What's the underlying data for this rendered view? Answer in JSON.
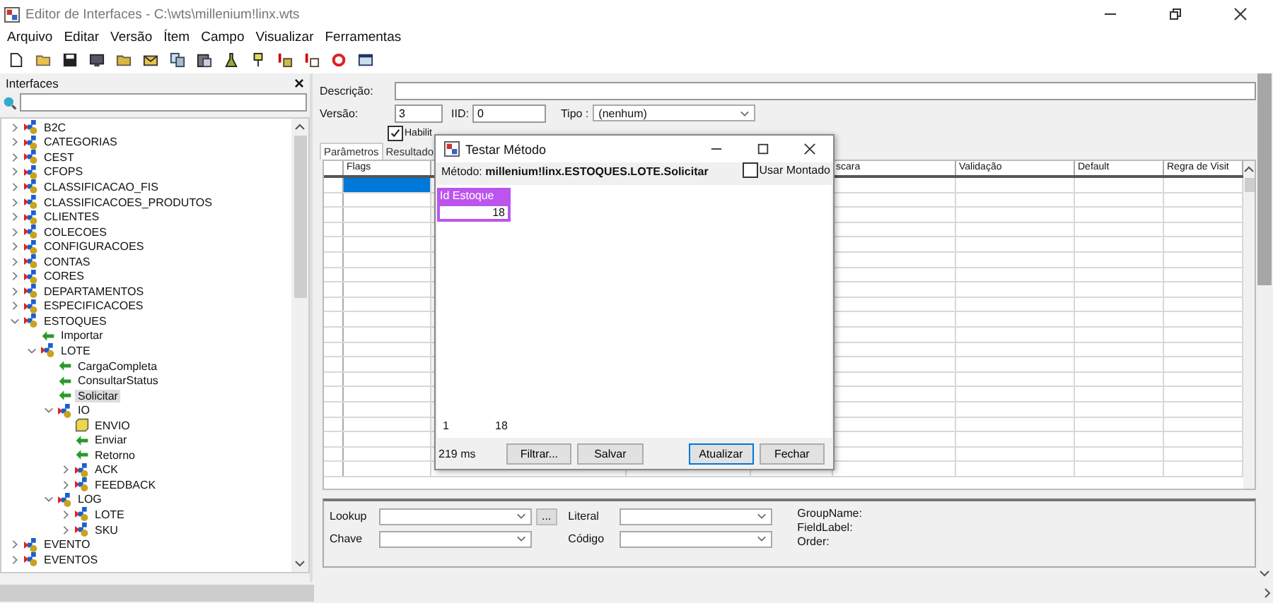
{
  "window": {
    "title": "Editor de Interfaces - C:\\wts\\millenium!linx.wts"
  },
  "menu": [
    "Arquivo",
    "Editar",
    "Versão",
    "Ítem",
    "Campo",
    "Visualizar",
    "Ferramentas"
  ],
  "interfaces_panel": {
    "title": "Interfaces",
    "close": "×",
    "tree": [
      {
        "label": "B2C",
        "kind": "folder",
        "expanded": false,
        "selected": false
      },
      {
        "label": "CATEGORIAS",
        "kind": "folder",
        "expanded": false,
        "selected": false
      },
      {
        "label": "CEST",
        "kind": "folder",
        "expanded": false,
        "selected": false
      },
      {
        "label": "CFOPS",
        "kind": "folder",
        "expanded": false,
        "selected": false
      },
      {
        "label": "CLASSIFICACAO_FIS",
        "kind": "folder",
        "expanded": false,
        "selected": false
      },
      {
        "label": "CLASSIFICACOES_PRODUTOS",
        "kind": "folder",
        "expanded": false,
        "selected": false
      },
      {
        "label": "CLIENTES",
        "kind": "folder",
        "expanded": false,
        "selected": false
      },
      {
        "label": "COLECOES",
        "kind": "folder",
        "expanded": false,
        "selected": false
      },
      {
        "label": "CONFIGURACOES",
        "kind": "folder",
        "expanded": false,
        "selected": false
      },
      {
        "label": "CONTAS",
        "kind": "folder",
        "expanded": false,
        "selected": false
      },
      {
        "label": "CORES",
        "kind": "folder",
        "expanded": false,
        "selected": false
      },
      {
        "label": "DEPARTAMENTOS",
        "kind": "folder",
        "expanded": false,
        "selected": false
      },
      {
        "label": "ESPECIFICACOES",
        "kind": "folder",
        "expanded": false,
        "selected": false
      },
      {
        "label": "ESTOQUES",
        "kind": "folder",
        "expanded": true,
        "selected": false,
        "children": [
          {
            "label": "Importar",
            "kind": "method",
            "selected": false
          },
          {
            "label": "LOTE",
            "kind": "folder",
            "expanded": true,
            "selected": false,
            "children": [
              {
                "label": "CargaCompleta",
                "kind": "method",
                "selected": false
              },
              {
                "label": "ConsultarStatus",
                "kind": "method",
                "selected": false
              },
              {
                "label": "Solicitar",
                "kind": "method",
                "selected": true
              },
              {
                "label": "IO",
                "kind": "folder",
                "expanded": true,
                "selected": false,
                "children": [
                  {
                    "label": "ENVIO",
                    "kind": "note",
                    "selected": false
                  },
                  {
                    "label": "Enviar",
                    "kind": "method",
                    "selected": false
                  },
                  {
                    "label": "Retorno",
                    "kind": "method",
                    "selected": false
                  },
                  {
                    "label": "ACK",
                    "kind": "folder",
                    "expanded": false,
                    "selected": false
                  },
                  {
                    "label": "FEEDBACK",
                    "kind": "folder",
                    "expanded": false,
                    "selected": false
                  }
                ]
              },
              {
                "label": "LOG",
                "kind": "folder",
                "expanded": true,
                "selected": false,
                "children": [
                  {
                    "label": "LOTE",
                    "kind": "folder",
                    "expanded": false,
                    "selected": false
                  },
                  {
                    "label": "SKU",
                    "kind": "folder",
                    "expanded": false,
                    "selected": false
                  }
                ]
              }
            ]
          }
        ]
      },
      {
        "label": "EVENTO",
        "kind": "folder",
        "expanded": false,
        "selected": false
      },
      {
        "label": "EVENTOS",
        "kind": "folder",
        "expanded": false,
        "selected": false
      }
    ]
  },
  "form": {
    "description_label": "Descrição:",
    "version_label": "Versão:",
    "version": "3",
    "iid_label": "IID:",
    "iid": "0",
    "tipo_label": "Tipo :",
    "tipo": "(nenhum)",
    "checkboxes": [
      {
        "label": "Habilit",
        "checked": true
      }
    ],
    "tabs": [
      {
        "label": "Parâmetros",
        "selected": true
      },
      {
        "label": "Resultado",
        "selected": false
      }
    ]
  },
  "grid": {
    "columns": [
      "Flags",
      null,
      null,
      null,
      "scara",
      "Validação",
      "Default",
      "Regra de Visit"
    ],
    "rows": [
      {
        "selected": true
      },
      {
        "selected": false
      },
      {
        "selected": false
      },
      {
        "selected": false
      },
      {
        "selected": false
      },
      {
        "selected": false
      },
      {
        "selected": false
      },
      {
        "selected": false
      },
      {
        "selected": false
      },
      {
        "selected": false
      },
      {
        "selected": false
      },
      {
        "selected": false
      },
      {
        "selected": false
      },
      {
        "selected": false
      },
      {
        "selected": false
      },
      {
        "selected": false
      },
      {
        "selected": false
      },
      {
        "selected": false
      },
      {
        "selected": false
      },
      {
        "selected": false
      }
    ]
  },
  "bottom_panel": {
    "lookup_label": "Lookup",
    "chave_label": "Chave",
    "browse": "...",
    "literal_label": "Literal",
    "codigo_label": "Código",
    "info": [
      "GroupName:",
      "FieldLabel:",
      "Order:"
    ]
  },
  "dialog": {
    "title": "Testar Método",
    "method_label": "Método:",
    "method": "millenium!linx.ESTOQUES.LOTE.Solicitar",
    "usar_montado": {
      "label": "Usar Montado",
      "checked": false
    },
    "result_column": "Id Estoque",
    "result_value": "18",
    "footer_row": "1",
    "footer_value": "18",
    "time": "219 ms",
    "buttons": [
      {
        "label": "Filtrar...",
        "default": false
      },
      {
        "label": "Salvar",
        "default": false
      },
      {
        "label": "Atualizar",
        "default": true
      },
      {
        "label": "Fechar",
        "default": false
      }
    ]
  }
}
